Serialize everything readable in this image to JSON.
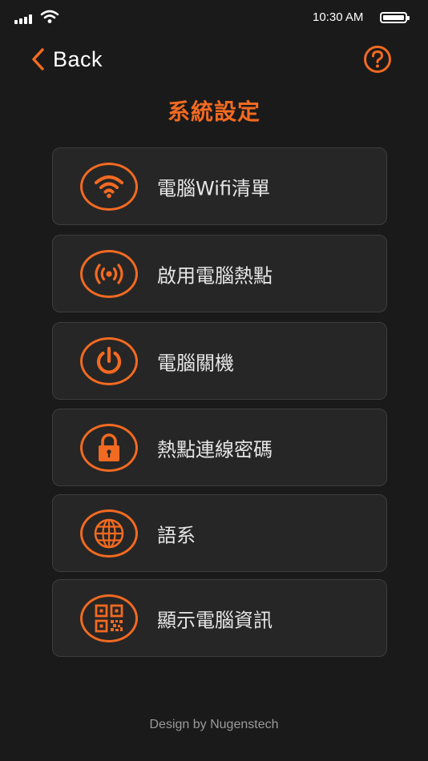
{
  "status_bar": {
    "time": "10:30 AM"
  },
  "nav": {
    "back_label": "Back"
  },
  "page": {
    "title": "系統設定"
  },
  "menu": {
    "items": [
      {
        "label": "電腦Wifi清單",
        "icon": "wifi-icon"
      },
      {
        "label": "啟用電腦熱點",
        "icon": "hotspot-icon"
      },
      {
        "label": "電腦關機",
        "icon": "power-icon"
      },
      {
        "label": "熱點連線密碼",
        "icon": "lock-icon"
      },
      {
        "label": "語系",
        "icon": "globe-icon"
      },
      {
        "label": "顯示電腦資訊",
        "icon": "qr-code-icon"
      }
    ]
  },
  "footer": {
    "text": "Design by Nugenstech"
  },
  "colors": {
    "accent": "#f26a21",
    "background": "#1a1a1a",
    "card": "#262626",
    "card_border": "#3d3d3d"
  }
}
